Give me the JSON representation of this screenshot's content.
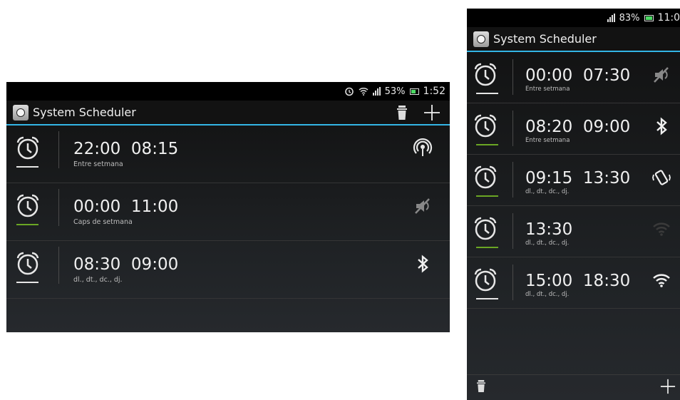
{
  "app": {
    "title": "System Scheduler"
  },
  "colors": {
    "accent": "#33b5e5",
    "active": "#6aa624",
    "inactive": "#e6e6e6"
  },
  "landscape": {
    "status": {
      "battery_percent": "53%",
      "time": "1:52"
    },
    "actions": {
      "delete_icon": "trash-icon",
      "add_icon": "plus-icon"
    },
    "schedules": [
      {
        "start": "22:00",
        "end": "08:15",
        "days": "Entre setmana",
        "active": false,
        "status_icon": "hotspot-icon"
      },
      {
        "start": "00:00",
        "end": "11:00",
        "days": "Caps de setmana",
        "active": true,
        "status_icon": "mute-icon"
      },
      {
        "start": "08:30",
        "end": "09:00",
        "days": "dl., dt., dc., dj.",
        "active": false,
        "status_icon": "bluetooth-icon"
      }
    ]
  },
  "portrait": {
    "status": {
      "battery_percent": "83%",
      "time": "11:0"
    },
    "schedules": [
      {
        "start": "00:00",
        "end": "07:30",
        "days": "Entre setmana",
        "active": false,
        "status_icon": "mute-icon"
      },
      {
        "start": "08:20",
        "end": "09:00",
        "days": "Entre setmana",
        "active": true,
        "status_icon": "bluetooth-icon"
      },
      {
        "start": "09:15",
        "end": "13:30",
        "days": "dl., dt., dc., dj.",
        "active": true,
        "status_icon": "vibrate-icon"
      },
      {
        "start": "13:30",
        "end": "",
        "days": "dl., dt., dc., dj.",
        "active": true,
        "status_icon": "wifi-off-icon"
      },
      {
        "start": "15:00",
        "end": "18:30",
        "days": "dl., dt., dc., dj.",
        "active": false,
        "status_icon": "wifi-icon"
      }
    ],
    "bottom": {
      "delete_icon": "trash-icon",
      "add_icon": "plus-icon"
    }
  }
}
